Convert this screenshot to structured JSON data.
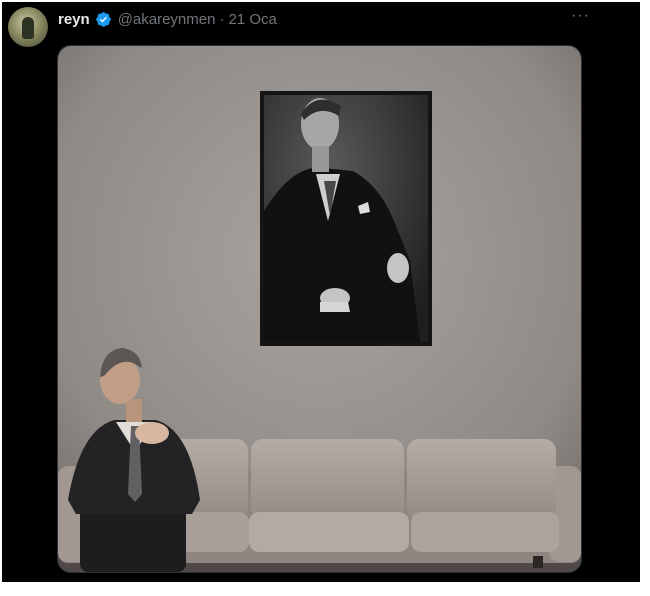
{
  "tweet": {
    "display_name": "reyn",
    "handle": "@akareynmen",
    "separator": "·",
    "date": "21 Oca",
    "more_glyph": "···",
    "verified_color": "#1d9bf0"
  },
  "icons": {
    "verified": "verified-badge-icon",
    "more": "more-options-icon"
  },
  "colors": {
    "background": "#000000",
    "name_text": "#e7e9ea",
    "secondary_text": "#71767b"
  }
}
